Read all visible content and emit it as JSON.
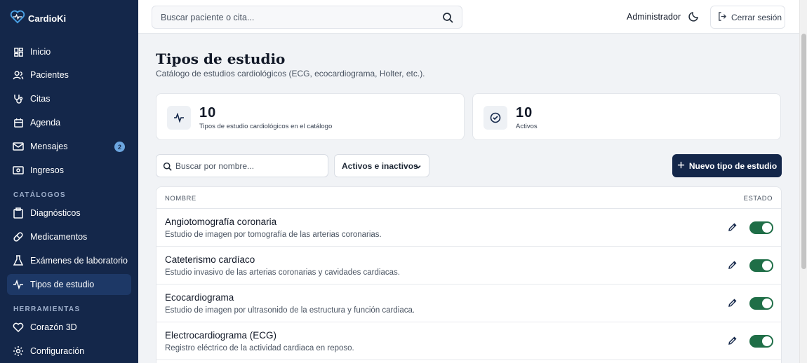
{
  "app": {
    "name": "CardioKi"
  },
  "sidebar": {
    "items": [
      {
        "label": "Inicio",
        "icon": "grid-icon"
      },
      {
        "label": "Pacientes",
        "icon": "users-icon"
      },
      {
        "label": "Citas",
        "icon": "stethoscope-icon"
      },
      {
        "label": "Agenda",
        "icon": "calendar-icon"
      },
      {
        "label": "Mensajes",
        "icon": "mail-icon",
        "badge": "2"
      },
      {
        "label": "Ingresos",
        "icon": "cash-icon"
      }
    ],
    "catalogs_title": "CATÁLOGOS",
    "catalogs": [
      {
        "label": "Diagnósticos",
        "icon": "clipboard-icon"
      },
      {
        "label": "Medicamentos",
        "icon": "pill-icon"
      },
      {
        "label": "Exámenes de laboratorio",
        "icon": "flask-icon"
      },
      {
        "label": "Tipos de estudio",
        "icon": "pulse-icon",
        "active": true
      }
    ],
    "tools_title": "HERRAMIENTAS",
    "tools": [
      {
        "label": "Corazón 3D",
        "icon": "heart-icon"
      },
      {
        "label": "Configuración",
        "icon": "gear-icon"
      }
    ]
  },
  "topbar": {
    "search_placeholder": "Buscar paciente o cita...",
    "user": "Administrador",
    "logout_label": "Cerrar sesión"
  },
  "page": {
    "title": "Tipos de estudio",
    "subtitle": "Catálogo de estudios cardiológicos (ECG, ecocardiograma, Holter, etc.)."
  },
  "stats": [
    {
      "value": "10",
      "label": "Tipos de estudio cardiológicos en el catálogo",
      "icon": "pulse-icon"
    },
    {
      "value": "10",
      "label": "Activos",
      "icon": "check-circle-icon"
    }
  ],
  "filters": {
    "search_placeholder": "Buscar por nombre...",
    "status_selected": "Activos e inactivos",
    "new_button": "Nuevo tipo de estudio"
  },
  "table": {
    "headers": {
      "name": "NOMBRE",
      "status": "ESTADO"
    },
    "rows": [
      {
        "name": "Angiotomografía coronaria",
        "description": "Estudio de imagen por tomografía de las arterias coronarias.",
        "active": true
      },
      {
        "name": "Cateterismo cardíaco",
        "description": "Estudio invasivo de las arterias coronarias y cavidades cardiacas.",
        "active": true
      },
      {
        "name": "Ecocardiograma",
        "description": "Estudio de imagen por ultrasonido de la estructura y función cardiaca.",
        "active": true
      },
      {
        "name": "Electrocardiograma (ECG)",
        "description": "Registro eléctrico de la actividad cardiaca en reposo.",
        "active": true
      }
    ]
  },
  "colors": {
    "sidebar": "#14274a",
    "primary": "#14274a",
    "toggle_on": "#1f6e47",
    "badge": "#6ca6e0"
  }
}
